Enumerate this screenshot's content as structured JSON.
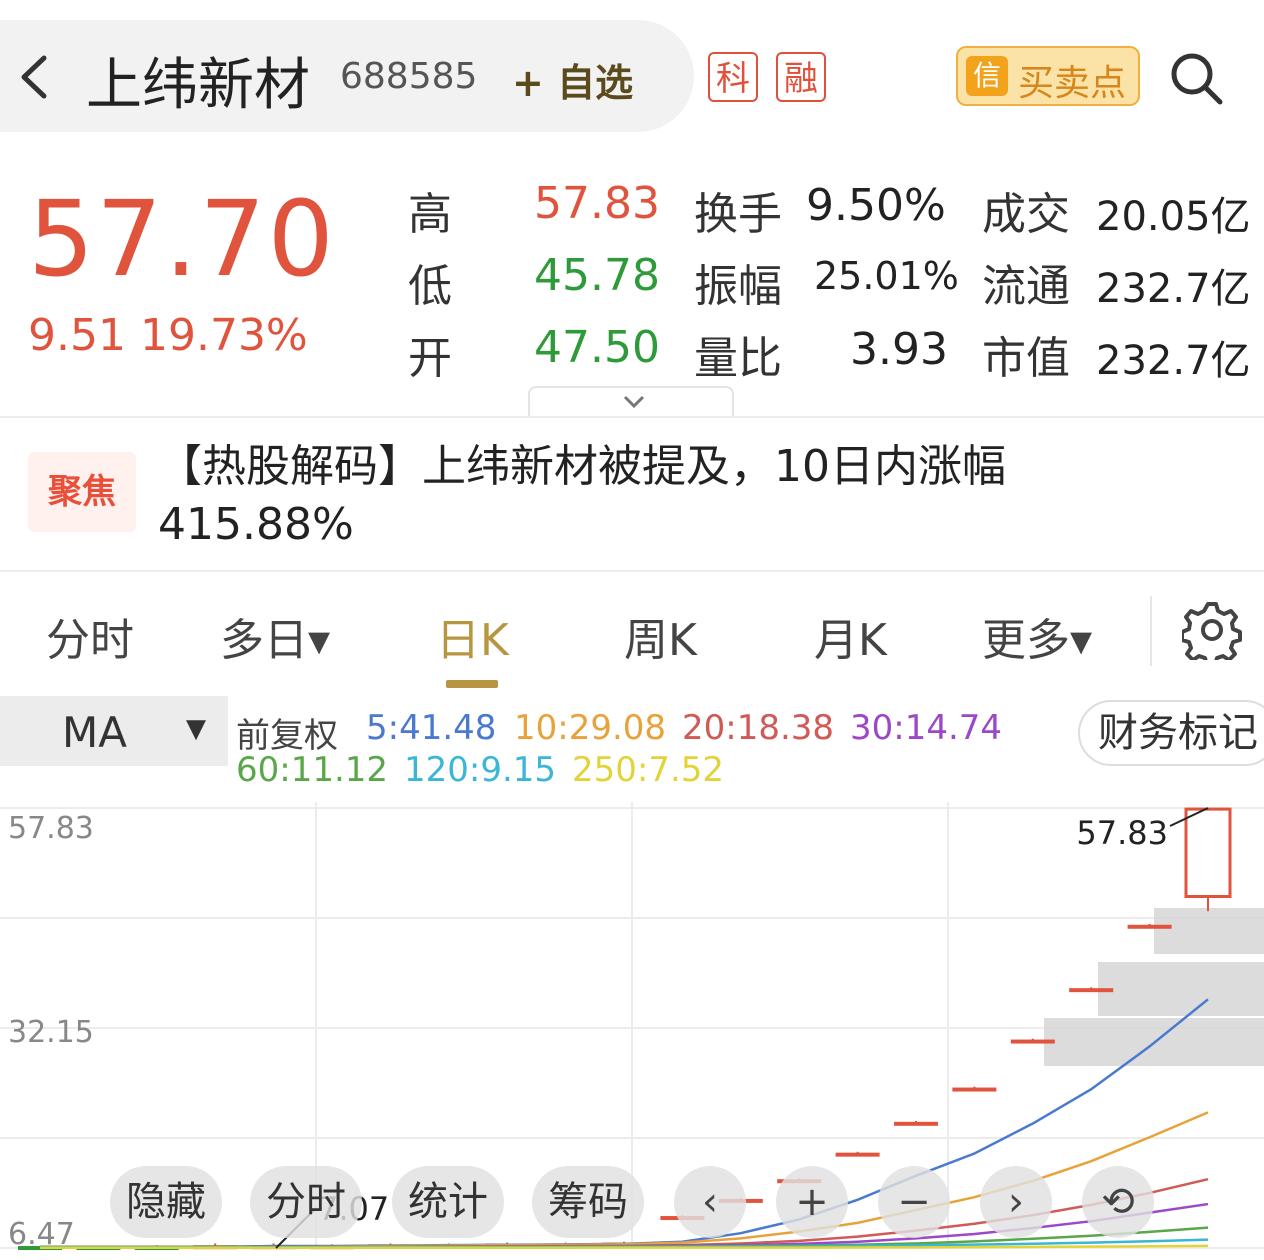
{
  "header": {
    "back_icon": "chevron-left-icon",
    "stock_name": "上纬新材",
    "stock_code": "688585",
    "watchlist_label": "+ 自选",
    "tags": [
      "科",
      "融"
    ],
    "trade_points_icon": "信",
    "trade_points_label": "买卖点",
    "search_icon": "search-icon"
  },
  "quote": {
    "price": "57.70",
    "change": "9.51",
    "change_pct": "19.73%",
    "high_label": "高",
    "high": "57.83",
    "low_label": "低",
    "low": "45.78",
    "open_label": "开",
    "open": "47.50",
    "turnover_label": "换手",
    "turnover": "9.50%",
    "amplitude_label": "振幅",
    "amplitude": "25.01%",
    "volume_ratio_label": "量比",
    "volume_ratio": "3.93",
    "amount_label": "成交",
    "amount": "20.05亿",
    "float_cap_label": "流通",
    "float_cap": "232.7亿",
    "market_cap_label": "市值",
    "market_cap": "232.7亿",
    "colors": {
      "up": "#e0533c",
      "down": "#2e9a3a"
    }
  },
  "news": {
    "badge": "聚焦",
    "text": "【热股解码】上纬新材被提及，10日内涨幅415.88%"
  },
  "tabs": [
    {
      "label": "分时"
    },
    {
      "label": "多日▾"
    },
    {
      "label": "日K",
      "active": true
    },
    {
      "label": "周K"
    },
    {
      "label": "月K"
    },
    {
      "label": "更多▾"
    }
  ],
  "settings_icon": "gear-icon",
  "ma_bar": {
    "selector": "MA",
    "selector_arrow": "▼",
    "adjust": "前复权",
    "items": [
      {
        "text": "5:41.48",
        "color": "#4a79d0"
      },
      {
        "text": "10:29.08",
        "color": "#e8a23a"
      },
      {
        "text": "20:18.38",
        "color": "#d05a55"
      },
      {
        "text": "30:14.74",
        "color": "#9c48c9"
      },
      {
        "text": "60:11.12",
        "color": "#5aa64a"
      },
      {
        "text": "120:9.15",
        "color": "#3ab6d6"
      },
      {
        "text": "250:7.52",
        "color": "#e3d33a"
      }
    ],
    "finance_button": "财务标记"
  },
  "chart_data": {
    "type": "candlestick",
    "y_axis_labels": [
      "57.83",
      "32.15",
      "6.47"
    ],
    "ylim": [
      6.47,
      57.83
    ],
    "annotations": {
      "high": "57.83",
      "low": "7.07"
    },
    "candles": [
      {
        "open": 6.6,
        "close": 6.7,
        "high": 6.7,
        "low": 6.5,
        "up": false
      },
      {
        "open": 6.6,
        "close": 6.7,
        "high": 6.7,
        "low": 6.5,
        "up": false
      },
      {
        "open": 6.6,
        "close": 6.7,
        "high": 6.8,
        "low": 6.5,
        "up": false
      },
      {
        "open": 6.8,
        "close": 6.7,
        "high": 7.0,
        "low": 6.5,
        "up": true
      },
      {
        "open": 6.8,
        "close": 6.8,
        "high": 7.0,
        "low": 6.7,
        "up": true
      },
      {
        "open": 6.8,
        "close": 6.8,
        "high": 6.9,
        "low": 6.7,
        "up": true
      },
      {
        "open": 6.8,
        "close": 6.9,
        "high": 7.0,
        "low": 6.7,
        "up": true
      },
      {
        "open": 6.9,
        "close": 6.9,
        "high": 7.0,
        "low": 6.8,
        "up": true
      },
      {
        "open": 6.9,
        "close": 7.0,
        "high": 7.1,
        "low": 6.8,
        "up": true
      },
      {
        "open": 7.0,
        "close": 7.0,
        "high": 7.1,
        "low": 6.9,
        "up": true
      },
      {
        "open": 7.0,
        "close": 7.1,
        "high": 7.2,
        "low": 6.9,
        "up": true
      },
      {
        "open": 9.9,
        "close": 10.2,
        "high": 10.3,
        "low": 9.8,
        "up": true
      },
      {
        "open": 12.0,
        "close": 12.2,
        "high": 12.3,
        "low": 11.9,
        "up": true
      },
      {
        "open": 14.3,
        "close": 14.5,
        "high": 14.6,
        "low": 14.2,
        "up": true
      },
      {
        "open": 17.4,
        "close": 17.6,
        "high": 17.7,
        "low": 17.3,
        "up": true
      },
      {
        "open": 21.0,
        "close": 21.2,
        "high": 21.3,
        "low": 20.9,
        "up": true
      },
      {
        "open": 25.0,
        "close": 25.2,
        "high": 25.3,
        "low": 24.9,
        "up": true
      },
      {
        "open": 30.6,
        "close": 30.8,
        "high": 30.9,
        "low": 30.5,
        "up": true
      },
      {
        "open": 36.6,
        "close": 36.8,
        "high": 36.9,
        "low": 36.5,
        "up": true
      },
      {
        "open": 44.0,
        "close": 44.2,
        "high": 44.3,
        "low": 44.0,
        "up": true
      },
      {
        "open": 47.5,
        "close": 57.7,
        "high": 57.83,
        "low": 45.78,
        "up": true
      }
    ],
    "ma_lines": [
      {
        "name": "5",
        "color": "#4a79d0",
        "values": [
          6.6,
          6.6,
          6.6,
          6.6,
          6.7,
          6.7,
          6.75,
          6.8,
          6.85,
          6.9,
          6.95,
          7.2,
          8.2,
          9.8,
          12.1,
          14.9,
          17.5,
          21.0,
          25.0,
          30.0,
          35.5
        ]
      },
      {
        "name": "10",
        "color": "#e8a23a",
        "values": [
          6.6,
          6.6,
          6.6,
          6.6,
          6.6,
          6.65,
          6.7,
          6.75,
          6.8,
          6.85,
          6.9,
          7.1,
          7.6,
          8.4,
          9.4,
          10.9,
          12.4,
          14.3,
          16.6,
          19.4,
          22.3
        ]
      },
      {
        "name": "20",
        "color": "#d05a55",
        "values": [
          6.6,
          6.6,
          6.6,
          6.6,
          6.6,
          6.6,
          6.62,
          6.65,
          6.68,
          6.7,
          6.72,
          6.8,
          7.0,
          7.3,
          7.8,
          8.5,
          9.3,
          10.3,
          11.5,
          12.9,
          14.5
        ]
      },
      {
        "name": "30",
        "color": "#9c48c9",
        "values": [
          6.6,
          6.6,
          6.6,
          6.6,
          6.6,
          6.6,
          6.6,
          6.62,
          6.64,
          6.66,
          6.68,
          6.72,
          6.8,
          6.95,
          7.2,
          7.6,
          8.1,
          8.8,
          9.6,
          10.6,
          11.6
        ]
      },
      {
        "name": "60",
        "color": "#5aa64a",
        "values": [
          6.6,
          6.6,
          6.6,
          6.6,
          6.6,
          6.6,
          6.6,
          6.6,
          6.6,
          6.62,
          6.63,
          6.65,
          6.7,
          6.75,
          6.85,
          7.0,
          7.25,
          7.55,
          7.9,
          8.35,
          8.85
        ]
      },
      {
        "name": "120",
        "color": "#3ab6d6",
        "values": [
          6.55,
          6.55,
          6.55,
          6.55,
          6.55,
          6.55,
          6.56,
          6.56,
          6.57,
          6.57,
          6.58,
          6.6,
          6.62,
          6.65,
          6.7,
          6.77,
          6.86,
          6.97,
          7.1,
          7.26,
          7.45
        ]
      },
      {
        "name": "250",
        "color": "#e3d33a",
        "values": [
          6.5,
          6.5,
          6.5,
          6.5,
          6.5,
          6.5,
          6.5,
          6.5,
          6.5,
          6.5,
          6.51,
          6.51,
          6.52,
          6.52,
          6.53,
          6.55,
          6.57,
          6.6,
          6.63,
          6.67,
          6.72
        ]
      }
    ]
  },
  "chart_controls": [
    {
      "label": "隐藏"
    },
    {
      "label": "分时"
    },
    {
      "label": "统计"
    },
    {
      "label": "筹码"
    }
  ],
  "chart_nav_icons": [
    "chevron-left-icon",
    "plus-icon",
    "minus-icon",
    "chevron-right-icon",
    "refresh-icon"
  ]
}
